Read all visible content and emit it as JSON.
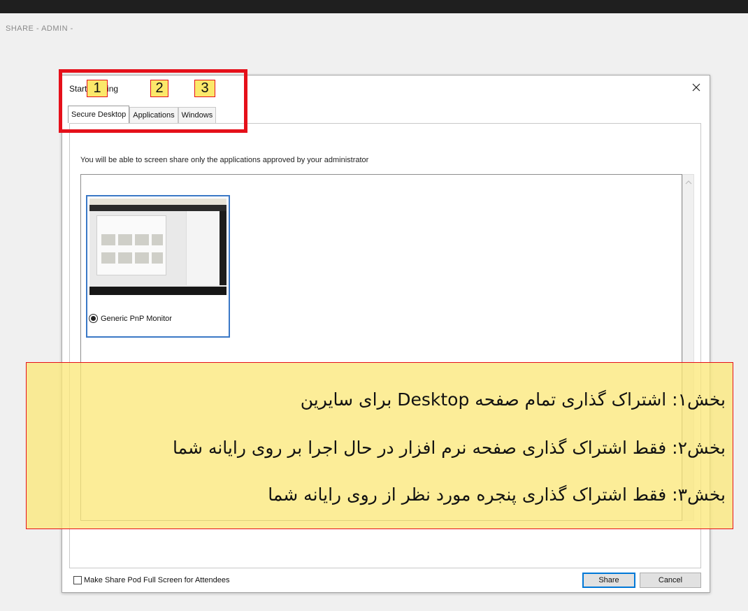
{
  "header": {
    "share_label": "SHARE - ADMIN -"
  },
  "dialog": {
    "title": "Start Sharing",
    "tabs": [
      {
        "label": "Secure Desktop"
      },
      {
        "label": "Applications"
      },
      {
        "label": "Windows"
      }
    ],
    "instruction": "You will be able to screen share only the applications approved by your administrator",
    "monitor": {
      "label": "Generic PnP Monitor",
      "selected": true
    },
    "fullscreen_checkbox": {
      "label": "Make Share Pod Full Screen for Attendees",
      "checked": false
    },
    "buttons": {
      "share": "Share",
      "cancel": "Cancel"
    }
  },
  "annotations": {
    "numbers": [
      "1",
      "2",
      "3"
    ],
    "highlight_color": "#e5101a",
    "note_color": "#fbe778",
    "notes": [
      "بخش۱: اشتراک گذاری تمام صفحه Desktop برای سایرین",
      "بخش۲: فقط اشتراک گذاری صفحه نرم افزار در حال اجرا بر روی رایانه شما",
      "بخش۳: فقط اشتراک گذاری پنجره مورد نظر از روی رایانه شما"
    ]
  },
  "icons": {
    "close": "close-icon",
    "scroll_up": "chevron-up-icon"
  }
}
